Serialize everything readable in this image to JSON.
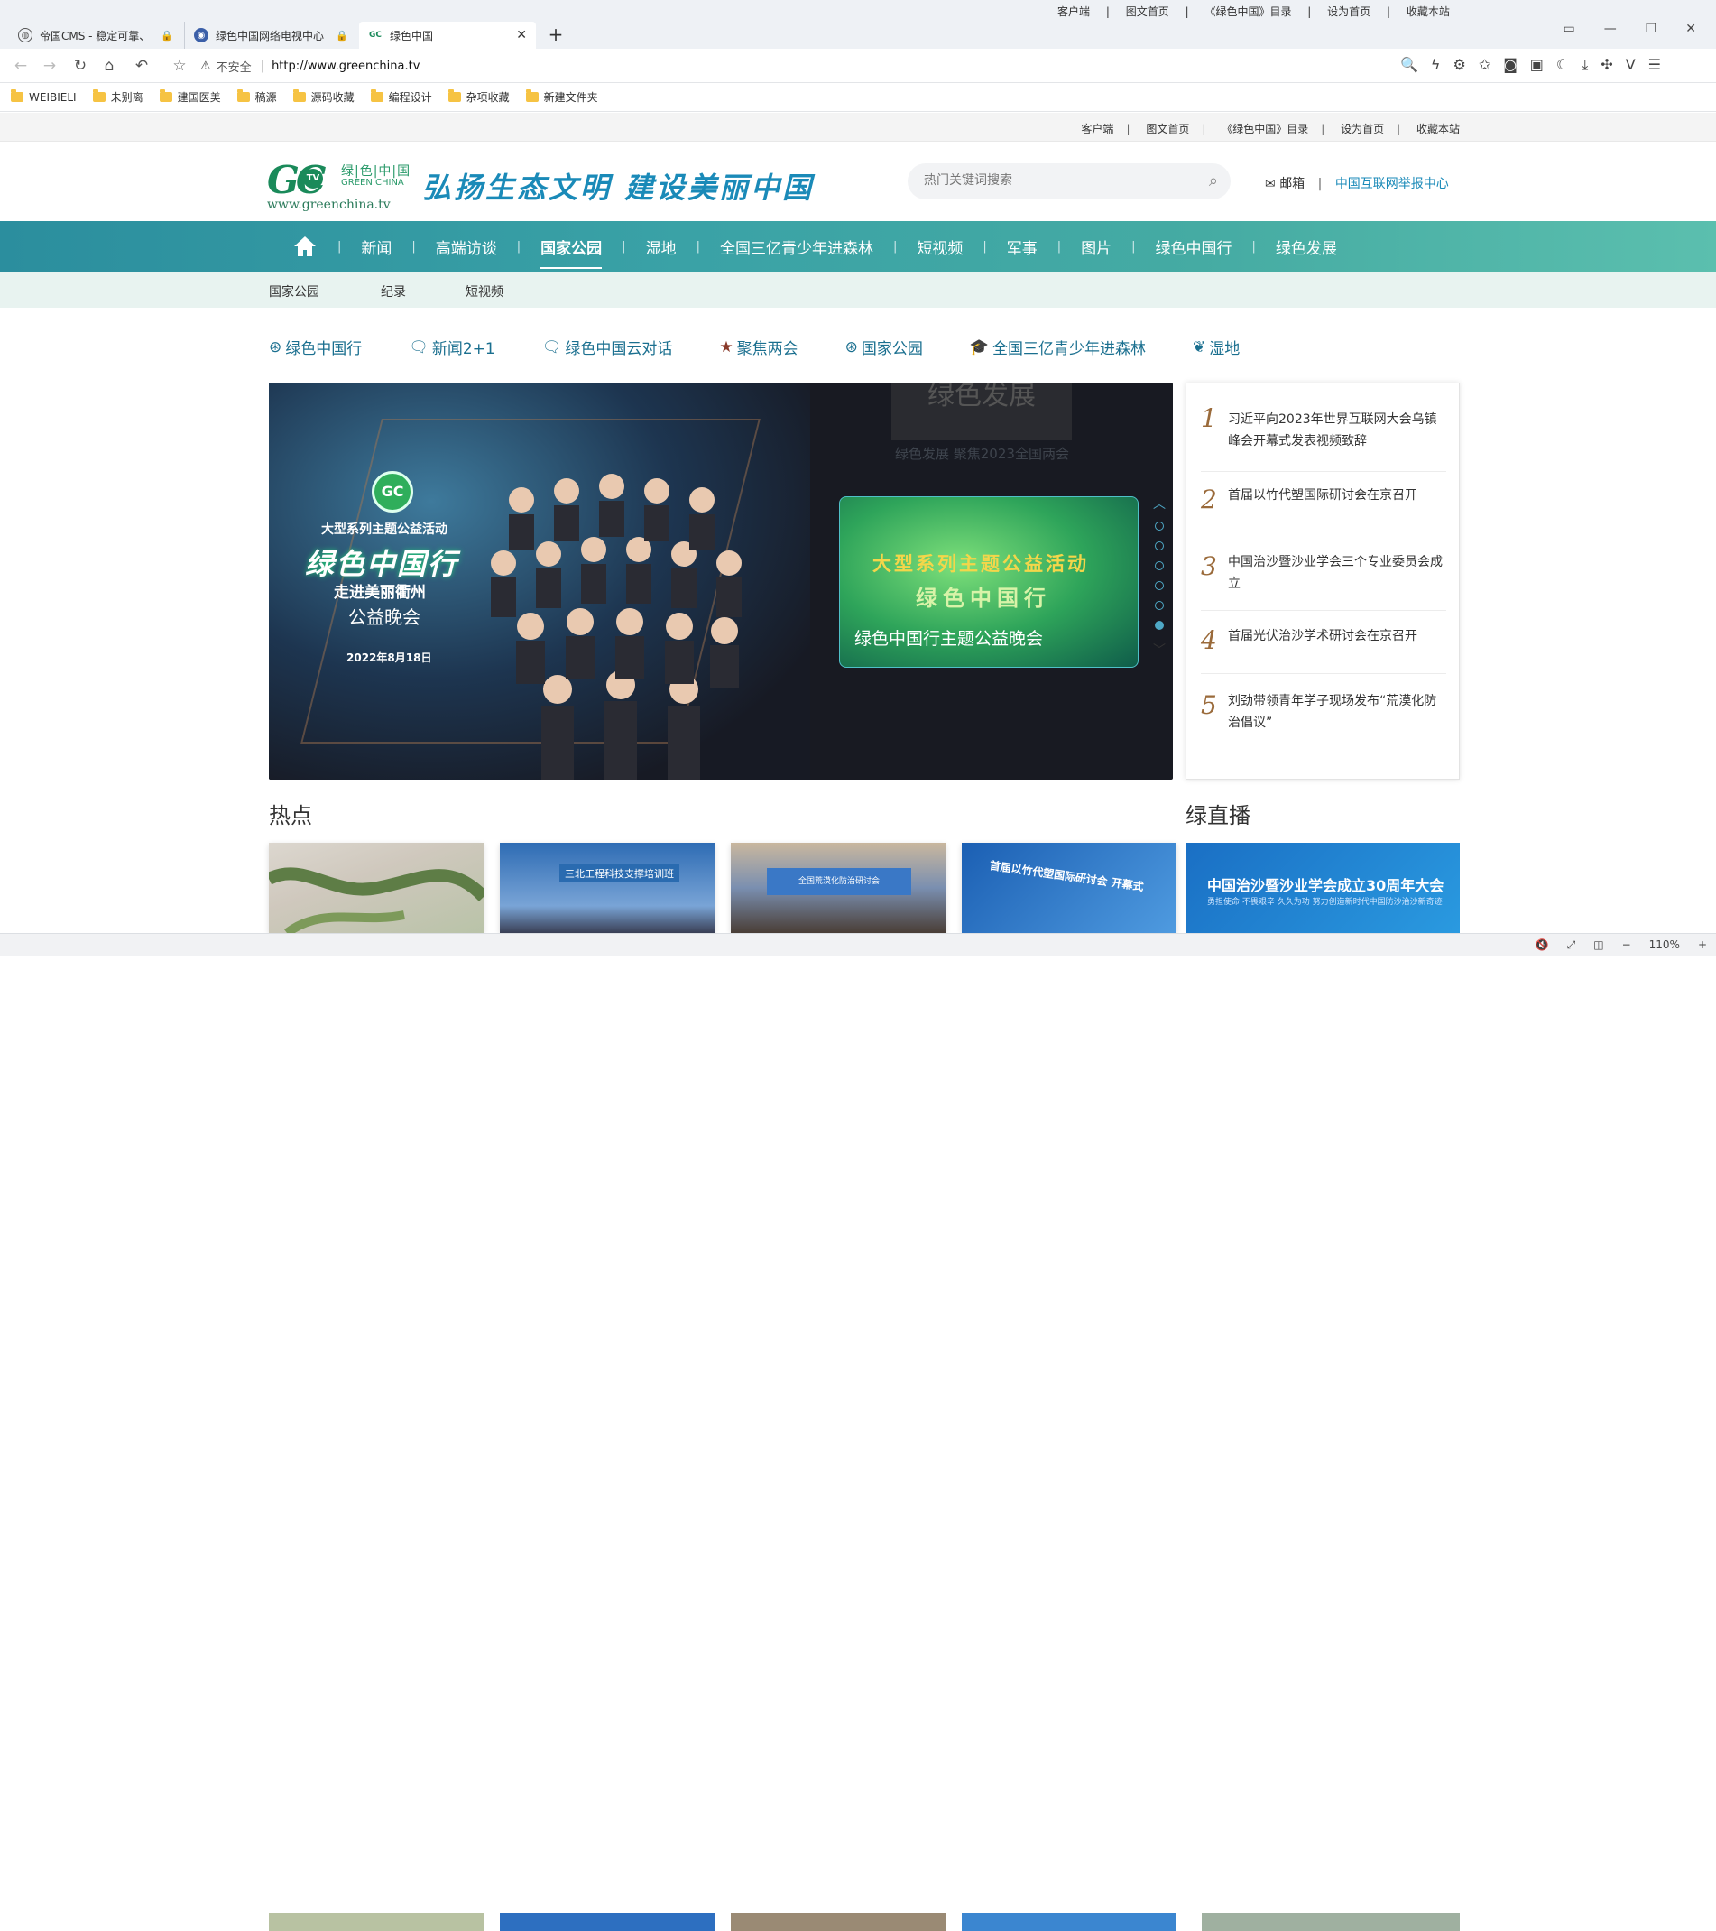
{
  "browser": {
    "tabs": [
      {
        "title": "帝国CMS - 稳定可靠、",
        "icon": "globe-icon"
      },
      {
        "title": "绿色中国网络电视中心_",
        "icon": "site-logo-icon"
      },
      {
        "title": "绿色中国",
        "icon": "gc-favicon-icon",
        "active": true
      }
    ],
    "overlay_links": [
      "客户端",
      "图文首页",
      "《绿色中国》目录",
      "设为首页",
      "收藏本站"
    ],
    "security_label": "不安全",
    "url": "http://www.greenchina.tv",
    "bookmarks": [
      "WEIBIELI",
      "未别离",
      "建国医美",
      "稿源",
      "源码收藏",
      "编程设计",
      "杂项收藏",
      "新建文件夹"
    ],
    "zoom": "110%"
  },
  "top_links": [
    "客户端",
    "图文首页",
    "《绿色中国》目录",
    "设为首页",
    "收藏本站"
  ],
  "header": {
    "logo_mark": "GC",
    "logo_tv": "TV",
    "logo_cn": "绿|色|中|国",
    "logo_en": "GREEN CHINA",
    "logo_url": "www.greenchina.tv",
    "slogan": "弘扬生态文明 建设美丽中国",
    "search_placeholder": "热门关键词搜索",
    "mail": "邮箱",
    "report": "中国互联网举报中心"
  },
  "main_nav": [
    "新闻",
    "高端访谈",
    "国家公园",
    "湿地",
    "全国三亿青少年进森林",
    "短视频",
    "军事",
    "图片",
    "绿色中国行",
    "绿色发展"
  ],
  "main_nav_active": "国家公园",
  "sub_nav": [
    "国家公园",
    "纪录",
    "短视频"
  ],
  "channels": [
    {
      "label": "绿色中国行",
      "icon": "globe-leaf-icon"
    },
    {
      "label": "新闻2+1",
      "icon": "chat-icon"
    },
    {
      "label": "绿色中国云对话",
      "icon": "chat-icon"
    },
    {
      "label": "聚焦两会",
      "icon": "star-icon"
    },
    {
      "label": "国家公园",
      "icon": "globe-leaf-icon"
    },
    {
      "label": "全国三亿青少年进森林",
      "icon": "graduation-cap-icon"
    },
    {
      "label": "湿地",
      "icon": "wetland-icon"
    }
  ],
  "banner": {
    "logo_text": "GC",
    "line1": "大型系列主题公益活动",
    "line2": "绿色中国行",
    "line3": "走进美丽衢州",
    "line4": "公益晚会",
    "date": "2022年8月18日",
    "ghost_title": "绿色发展",
    "ghost_sub": "绿色发展 聚焦2023全国两会",
    "card_title": "大型系列主题公益活动",
    "card_title2": "绿色中国行",
    "card_caption": "绿色中国行主题公益晚会",
    "slide_count": 6,
    "active_slide": 6
  },
  "ranking": [
    {
      "num": "1",
      "text": "习近平向2023年世界互联网大会乌镇峰会开幕式发表视频致辞"
    },
    {
      "num": "2",
      "text": "首届以竹代塑国际研讨会在京召开"
    },
    {
      "num": "3",
      "text": "中国治沙暨沙业学会三个专业委员会成立"
    },
    {
      "num": "4",
      "text": "首届光伏治沙学术研讨会在京召开"
    },
    {
      "num": "5",
      "text": "刘劲带领青年学子现场发布“荒漠化防治倡议”"
    }
  ],
  "sections": {
    "hot": "热点",
    "live": "绿直播"
  },
  "thumbs": [
    {
      "caption": ""
    },
    {
      "caption": "三北工程科技支撑培训班"
    },
    {
      "caption": "全国荒漠化防治研讨会"
    },
    {
      "caption": "首届以竹代塑国际研讨会 开幕式"
    }
  ],
  "live_card": {
    "title": "中国治沙暨沙业学会成立30周年大会",
    "subtitle": "勇担使命  不畏艰辛  久久为功  努力创造新时代中国防沙治沙新奇迹"
  },
  "colors": {
    "nav_gradient_start": "#2b8e9e",
    "nav_gradient_end": "#5bbfae",
    "brand_green": "#1a8a5a",
    "slogan_blue": "#1a8ab8",
    "subnav_bg": "#e8f3f0"
  }
}
